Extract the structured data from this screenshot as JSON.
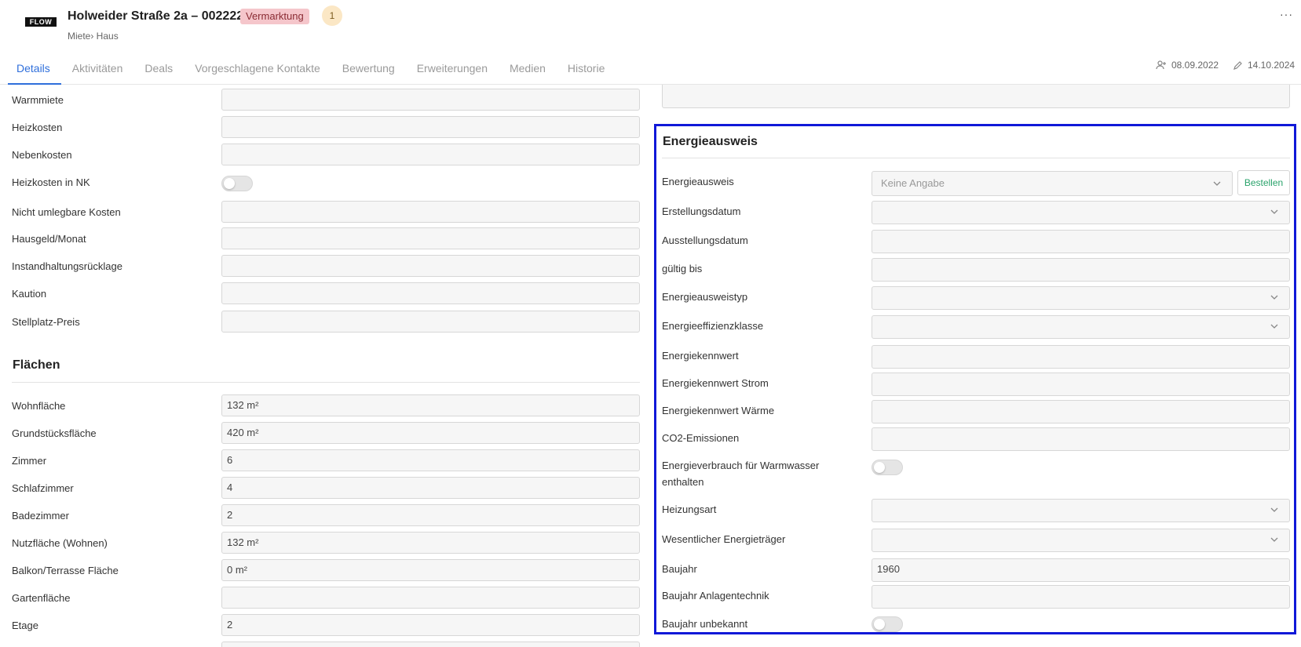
{
  "header": {
    "logo_text": "FLOW",
    "title": "Holweider Straße 2a – 002222",
    "status_badge": "Vermarktung",
    "count_badge": "1",
    "breadcrumb": "Miete› Haus",
    "more_label": "···",
    "created_date": "08.09.2022",
    "modified_date": "14.10.2024"
  },
  "tabs": [
    {
      "label": "Details",
      "active": true
    },
    {
      "label": "Aktivitäten",
      "active": false
    },
    {
      "label": "Deals",
      "active": false
    },
    {
      "label": "Vorgeschlagene Kontakte",
      "active": false
    },
    {
      "label": "Bewertung",
      "active": false
    },
    {
      "label": "Erweiterungen",
      "active": false
    },
    {
      "label": "Medien",
      "active": false
    },
    {
      "label": "Historie",
      "active": false
    }
  ],
  "costs": {
    "warmmiete": {
      "label": "Warmmiete",
      "value": ""
    },
    "heizkosten": {
      "label": "Heizkosten",
      "value": ""
    },
    "nebenkosten": {
      "label": "Nebenkosten",
      "value": ""
    },
    "heizkosten_in_nk": {
      "label": "Heizkosten in NK",
      "on": false
    },
    "nicht_umlegbar": {
      "label": "Nicht umlegbare Kosten",
      "value": ""
    },
    "hausgeld": {
      "label": "Hausgeld/Monat",
      "value": ""
    },
    "instandhaltung": {
      "label": "Instandhaltungsrücklage",
      "value": ""
    },
    "kaution": {
      "label": "Kaution",
      "value": ""
    },
    "stellplatz": {
      "label": "Stellplatz-Preis",
      "value": ""
    }
  },
  "flaechen": {
    "title": "Flächen",
    "wohnflaeche": {
      "label": "Wohnfläche",
      "value": "132 m²"
    },
    "grundstueck": {
      "label": "Grundstücksfläche",
      "value": "420 m²"
    },
    "zimmer": {
      "label": "Zimmer",
      "value": "6"
    },
    "schlafzimmer": {
      "label": "Schlafzimmer",
      "value": "4"
    },
    "badezimmer": {
      "label": "Badezimmer",
      "value": "2"
    },
    "nutzflaeche": {
      "label": "Nutzfläche (Wohnen)",
      "value": "132 m²"
    },
    "balkon": {
      "label": "Balkon/Terrasse Fläche",
      "value": "0 m²"
    },
    "garten": {
      "label": "Gartenfläche",
      "value": ""
    },
    "etage": {
      "label": "Etage",
      "value": "2"
    }
  },
  "energie": {
    "title": "Energieausweis",
    "ausweis": {
      "label": "Energieausweis",
      "value": "Keine Angabe"
    },
    "bestellen_label": "Bestellen",
    "erstellungsdatum": {
      "label": "Erstellungsdatum",
      "value": ""
    },
    "ausstellungsdatum": {
      "label": "Ausstellungsdatum",
      "value": ""
    },
    "gueltig_bis": {
      "label": "gültig bis",
      "value": ""
    },
    "ausweistyp": {
      "label": "Energieausweistyp",
      "value": ""
    },
    "effizienzklasse": {
      "label": "Energieeffizienzklasse",
      "value": ""
    },
    "kennwert": {
      "label": "Energiekennwert",
      "value": ""
    },
    "kennwert_strom": {
      "label": "Energiekennwert Strom",
      "value": ""
    },
    "kennwert_waerme": {
      "label": "Energiekennwert Wärme",
      "value": ""
    },
    "co2": {
      "label": "CO2-Emissionen",
      "value": ""
    },
    "warmwasser_line1": "Energieverbrauch für Warmwasser",
    "warmwasser_line2": "enthalten",
    "warmwasser_on": false,
    "heizungsart": {
      "label": "Heizungsart",
      "value": ""
    },
    "energietraeger": {
      "label": "Wesentlicher Energieträger",
      "value": ""
    },
    "baujahr": {
      "label": "Baujahr",
      "value": "1960"
    },
    "baujahr_anlagen": {
      "label": "Baujahr Anlagentechnik",
      "value": ""
    },
    "baujahr_unbekannt": {
      "label": "Baujahr unbekannt",
      "on": false
    }
  },
  "colors": {
    "accent": "#2f6fdb",
    "badge_bg": "#f5c6cb",
    "count_bg": "#fbe7c5",
    "highlight_border": "#1018d8",
    "order_button_text": "#2aa36b"
  }
}
